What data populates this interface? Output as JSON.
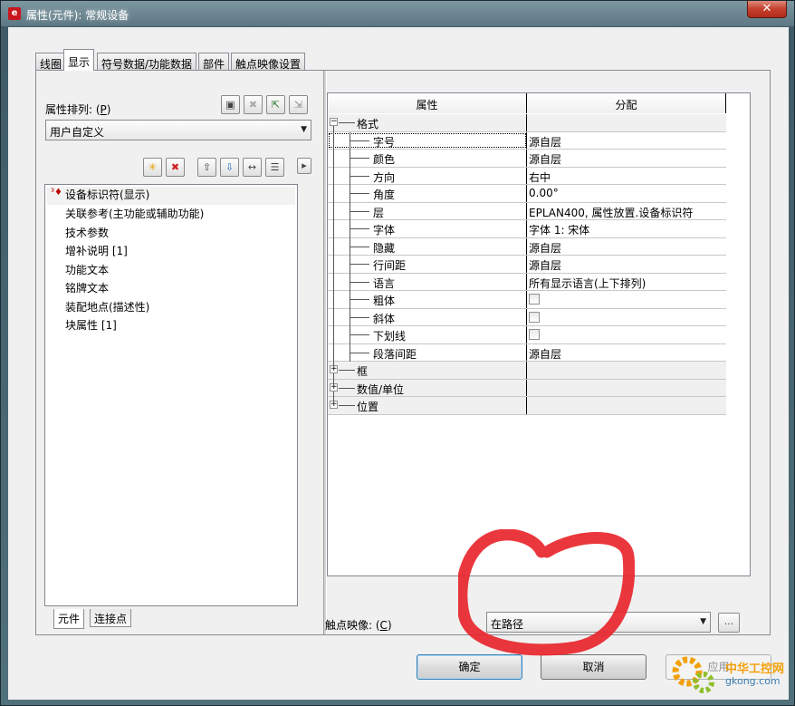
{
  "window": {
    "title": "属性(元件): 常规设备",
    "app_icon": "eplan-icon",
    "close_label": "✕"
  },
  "tabs": [
    {
      "label": "线圈",
      "active": false
    },
    {
      "label": "显示",
      "active": true
    },
    {
      "label": "符号数据/功能数据",
      "active": false
    },
    {
      "label": "部件",
      "active": false
    },
    {
      "label": "触点映像设置",
      "active": false
    }
  ],
  "left_pane": {
    "sort_label_prefix": "属性排列: (",
    "sort_label_key": "P",
    "sort_label_suffix": ")",
    "sort_value": "用户自定义",
    "toolbar_icons": [
      "save-icon",
      "delete-scheme-icon",
      "import-icon",
      "export-icon"
    ],
    "list_toolbar_icons": [
      "new-icon",
      "delete-icon",
      "move-up-icon",
      "move-down-icon",
      "fit-width-icon",
      "row-height-icon",
      "more-icon"
    ],
    "items": [
      {
        "label": "设备标识符(显示)",
        "selected": true
      },
      {
        "label": "关联参考(主功能或辅助功能)",
        "selected": false
      },
      {
        "label": "技术参数",
        "selected": false
      },
      {
        "label": "增补说明 [1]",
        "selected": false
      },
      {
        "label": "功能文本",
        "selected": false
      },
      {
        "label": "铭牌文本",
        "selected": false
      },
      {
        "label": "装配地点(描述性)",
        "selected": false
      },
      {
        "label": "块属性 [1]",
        "selected": false
      }
    ],
    "bottom_tabs": [
      {
        "label": "元件",
        "active": true
      },
      {
        "label": "连接点",
        "active": false
      }
    ]
  },
  "grid": {
    "col_property": "属性",
    "col_value": "分配",
    "rows": [
      {
        "name": "格式",
        "value": "",
        "level": 0,
        "group": true,
        "expander": "−"
      },
      {
        "name": "字号",
        "value": "源自层",
        "level": 1,
        "group": false
      },
      {
        "name": "颜色",
        "value": "源自层",
        "level": 1,
        "group": false
      },
      {
        "name": "方向",
        "value": "右中",
        "level": 1,
        "group": false
      },
      {
        "name": "角度",
        "value": "0.00°",
        "level": 1,
        "group": false
      },
      {
        "name": "层",
        "value": "EPLAN400, 属性放置.设备标识符",
        "level": 1,
        "group": false
      },
      {
        "name": "字体",
        "value": "字体 1: 宋体",
        "level": 1,
        "group": false
      },
      {
        "name": "隐藏",
        "value": "源自层",
        "level": 1,
        "group": false
      },
      {
        "name": "行间距",
        "value": "源自层",
        "level": 1,
        "group": false
      },
      {
        "name": "语言",
        "value": "所有显示语言(上下排列)",
        "level": 1,
        "group": false
      },
      {
        "name": "粗体",
        "value": "",
        "level": 1,
        "group": false,
        "checkbox": true
      },
      {
        "name": "斜体",
        "value": "",
        "level": 1,
        "group": false,
        "checkbox": true
      },
      {
        "name": "下划线",
        "value": "",
        "level": 1,
        "group": false,
        "checkbox": true
      },
      {
        "name": "段落间距",
        "value": "源自层",
        "level": 1,
        "group": false
      },
      {
        "name": "框",
        "value": "",
        "level": 0,
        "group": true,
        "expander": "+"
      },
      {
        "name": "数值/单位",
        "value": "",
        "level": 0,
        "group": true,
        "expander": "+"
      },
      {
        "name": "位置",
        "value": "",
        "level": 0,
        "group": true,
        "expander": "+"
      }
    ]
  },
  "contact_image": {
    "label_prefix": "触点映像: (",
    "label_key": "C",
    "label_suffix": ")",
    "value": "在路径",
    "browse_label": "..."
  },
  "buttons": {
    "ok": "确定",
    "cancel": "取消",
    "apply": "应用"
  },
  "watermark": {
    "line1": "中华工控网",
    "line2": "gkong.com"
  },
  "colors": {
    "annotation_red": "#e8262c",
    "titlebar": "#5c7783",
    "close_red": "#c4402c"
  }
}
